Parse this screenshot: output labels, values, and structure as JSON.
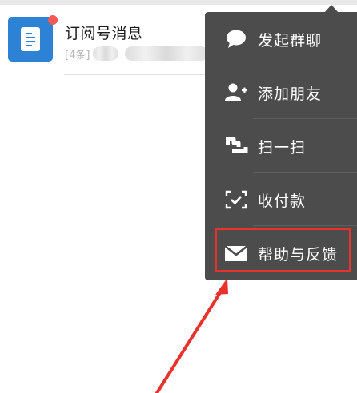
{
  "chat": {
    "title": "订阅号消息",
    "preview_count": "[4条]"
  },
  "menu": {
    "items": [
      {
        "label": "发起群聊",
        "icon": "chat-bubble-icon"
      },
      {
        "label": "添加朋友",
        "icon": "add-friend-icon"
      },
      {
        "label": "扫一扫",
        "icon": "scan-icon"
      },
      {
        "label": "收付款",
        "icon": "payment-scan-icon"
      },
      {
        "label": "帮助与反馈",
        "icon": "envelope-icon"
      }
    ]
  },
  "colors": {
    "menu_bg": "#4c4c4c",
    "accent_blue": "#2e82d6",
    "badge_red": "#f25a53",
    "annotation_red": "#e8322c"
  }
}
